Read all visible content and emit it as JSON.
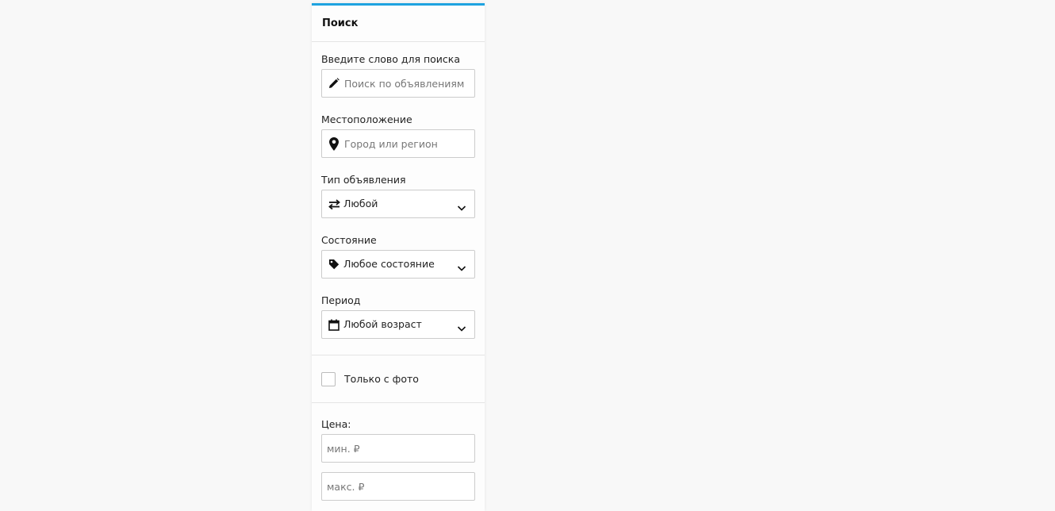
{
  "panel": {
    "title": "Поиск",
    "accent_color": "#1fa3e0"
  },
  "search": {
    "label": "Введите слово для поиска",
    "placeholder": "Поиск по объявлениям",
    "icon": "pencil-icon"
  },
  "location": {
    "label": "Местоположение",
    "placeholder": "Город или регион",
    "icon": "map-pin-icon"
  },
  "ad_type": {
    "label": "Тип объявления",
    "value": "Любой",
    "icon": "swap-arrows-icon"
  },
  "condition": {
    "label": "Состояние",
    "value": "Любое состояние",
    "icon": "tag-icon"
  },
  "period": {
    "label": "Период",
    "value": "Любой возраст",
    "icon": "calendar-icon"
  },
  "photo_only": {
    "label": "Только с фото",
    "checked": false
  },
  "price": {
    "label": "Цена:",
    "min_placeholder": "мин. ₽",
    "max_placeholder": "макс. ₽"
  }
}
